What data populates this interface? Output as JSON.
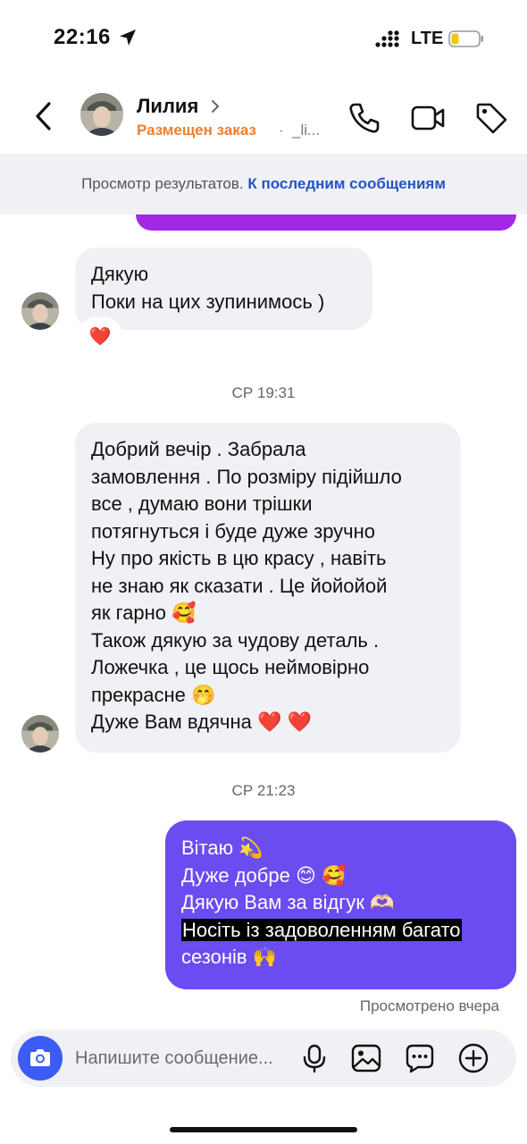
{
  "status_bar": {
    "time": "22:16",
    "network": "LTE"
  },
  "header": {
    "name": "Лилия",
    "subtitle": "Размещен заказ",
    "separator": "·",
    "handle": "_li..."
  },
  "banner": {
    "text": "Просмотр результатов.",
    "link": "К последним сообщениям"
  },
  "messages": {
    "m1": {
      "lines": [
        "Дякую",
        "Поки на цих зупинимось )"
      ],
      "reaction": "❤️"
    },
    "ts1": "СР 19:31",
    "m2": {
      "lines": [
        "Добрий вечір . Забрала",
        "замовлення . По розміру підійшло",
        "все , думаю вони трішки",
        "потягнуться і буде дуже зручно",
        "Ну про якість в цю красу , навіть",
        "не знаю як сказати . Це йойойой",
        "як гарно 🥰",
        "Також дякую за чудову деталь .",
        "Ложечка , це щось  неймовірно",
        "прекрасне 🤭",
        "Дуже Вам вдячна ❤️ ❤️"
      ]
    },
    "ts2": "СР 21:23",
    "m3": {
      "lines": [
        "Вітаю 💫",
        "Дуже добре 😊 🥰",
        "Дякую Вам за відгук 🫶🏻",
        "Носіть із задоволенням багато",
        "сезонів 🙌"
      ]
    },
    "seen": "Просмотрено вчера"
  },
  "composer": {
    "placeholder": "Напишите сообщение..."
  },
  "colors": {
    "accent_blue": "#3b5cf5",
    "outgoing_bubble": "#6a4cf0",
    "incoming_bubble": "#eff1f4",
    "order_status": "#ee7f2d",
    "link": "#2453c6",
    "previous_bubble": "#a228e6"
  },
  "icons": {
    "status": [
      "location-arrow-icon",
      "signal-icon",
      "battery-icon"
    ],
    "header": [
      "back-icon",
      "phone-icon",
      "video-icon",
      "tag-icon"
    ],
    "composer": [
      "camera-icon",
      "microphone-icon",
      "gallery-icon",
      "sticker-icon",
      "plus-icon"
    ]
  }
}
